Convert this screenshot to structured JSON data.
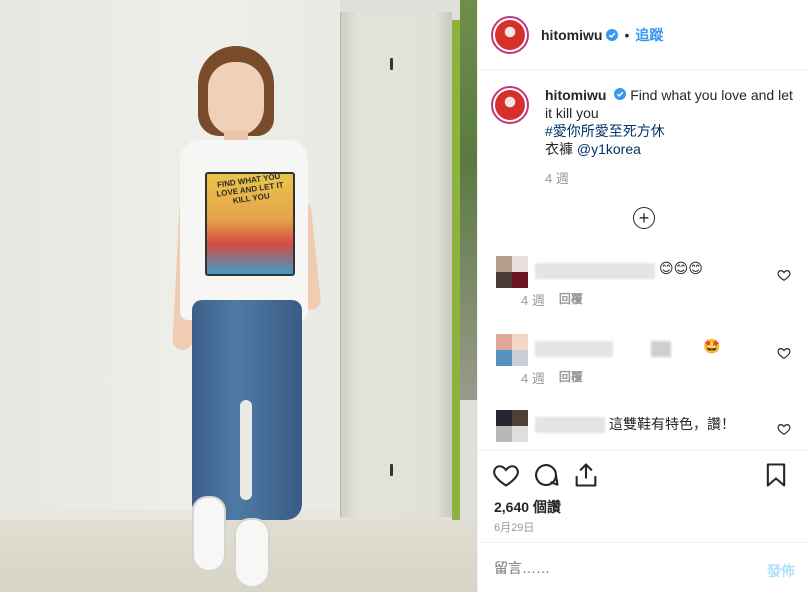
{
  "post": {
    "username": "hitomiwu",
    "dot": "•",
    "follow_label": "追蹤"
  },
  "caption": {
    "username": "hitomiwu",
    "text": "Find what you love and let it kill you",
    "hashtag": "#愛你所愛至死方休",
    "credit_prefix": "衣褲 ",
    "credit_mention": "@y1korea",
    "time": "4 週"
  },
  "comments": [
    {
      "text": "😊😊😊",
      "time": "4 週",
      "reply": "回覆"
    },
    {
      "text": "🤩",
      "time": "4 週",
      "reply": "回覆"
    },
    {
      "text": "這雙鞋有特色，讚！"
    }
  ],
  "stats": {
    "likes": "2,640 個讚",
    "date": "6月29日"
  },
  "comment_box": {
    "placeholder": "留言……",
    "post_label": "發佈"
  },
  "photo": {
    "shirt_text": "FIND WHAT YOU LOVE AND LET IT KILL YOU"
  },
  "colors": {
    "link": "#003569",
    "follow": "#3897f0",
    "verified": "#3897f0"
  }
}
